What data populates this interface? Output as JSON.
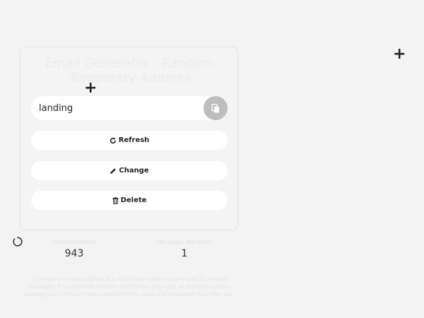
{
  "card": {
    "title": "Email Generator - Random Temporary Address"
  },
  "email": {
    "value": "landing"
  },
  "actions": {
    "refresh_label": "Refresh",
    "change_label": "Change",
    "delete_label": "Delete"
  },
  "stats": {
    "emails_label": "Emails Created",
    "emails_value": "943",
    "messages_label": "Messages Received",
    "messages_value": "1"
  },
  "description": "A temporary email address is a short-term email account used to receive messages. It's commonly used for verification, sign-ups, or one-time access, keeping your primary inbox protected from spam and unwanted mail after use.",
  "icons": {
    "copy": "copy-icon",
    "refresh": "refresh-icon",
    "change": "pencil-icon",
    "delete": "trash-icon",
    "plus": "plus-icon",
    "spinner": "spinner-icon"
  }
}
